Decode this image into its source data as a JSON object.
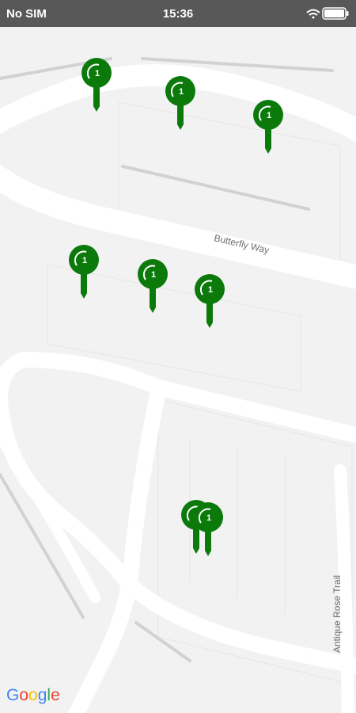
{
  "status_bar": {
    "carrier": "No SIM",
    "time": "15:36",
    "icons": [
      "wifi-icon",
      "battery-icon"
    ]
  },
  "map": {
    "street_labels": {
      "butterfly": "Butterfly Way",
      "antique": "Antique Rose Trail"
    },
    "pins": [
      {
        "id": "pin-1",
        "label": "1"
      },
      {
        "id": "pin-2",
        "label": "1"
      },
      {
        "id": "pin-3",
        "label": "1"
      },
      {
        "id": "pin-4",
        "label": "1"
      },
      {
        "id": "pin-5",
        "label": "1"
      },
      {
        "id": "pin-6",
        "label": "1"
      },
      {
        "id": "pin-7",
        "label": "1"
      },
      {
        "id": "pin-8",
        "label": "1"
      }
    ],
    "pin_color": "#0b7a0b"
  },
  "attribution": {
    "letters": [
      "G",
      "o",
      "o",
      "g",
      "l",
      "e"
    ],
    "colors": [
      "#4285F4",
      "#EA4335",
      "#FBBC05",
      "#4285F4",
      "#34A853",
      "#EA4335"
    ]
  }
}
